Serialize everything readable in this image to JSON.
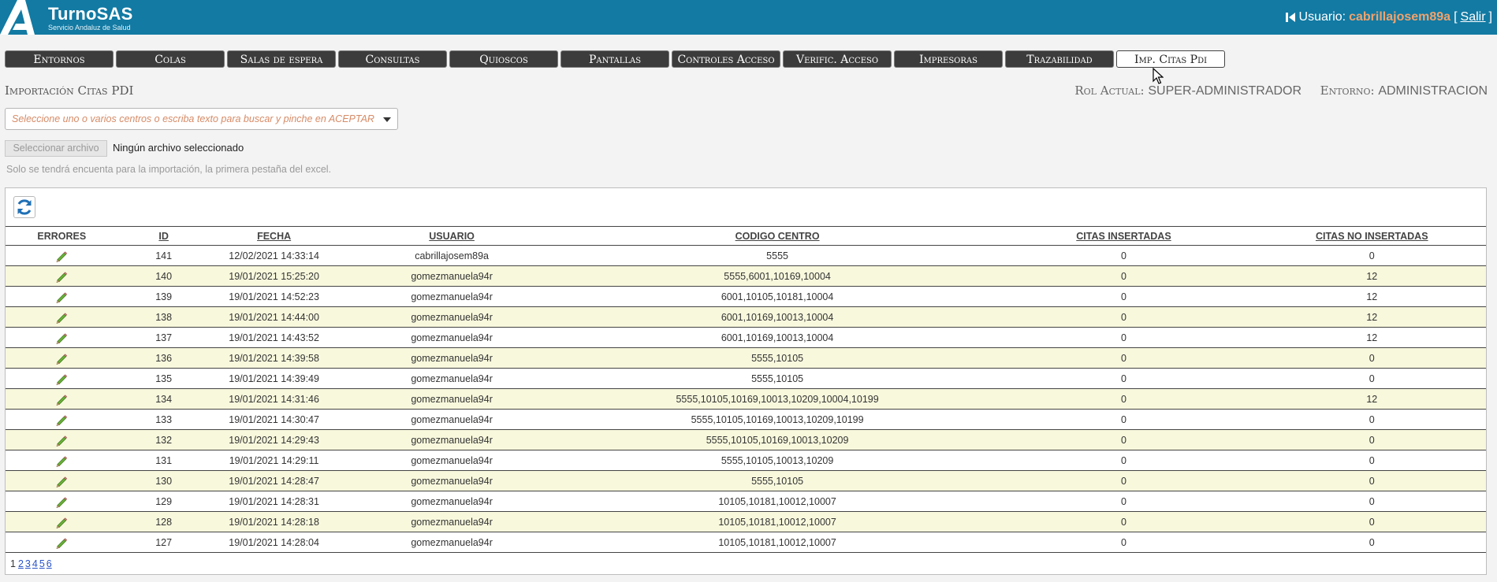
{
  "header": {
    "brand_title": "TurnoSAS",
    "brand_subtitle": "Servicio Andaluz de Salud",
    "user_label": "Usuario:",
    "user_name": "cabrillajosem89a",
    "logout_open": "[",
    "logout_label": "Salir",
    "logout_close": "]",
    "colors": {
      "bar": "#127aa3",
      "user_name": "#f0a36e"
    }
  },
  "tabs": [
    {
      "label": "Entornos",
      "active": false
    },
    {
      "label": "Colas",
      "active": false
    },
    {
      "label": "Salas de espera",
      "active": false
    },
    {
      "label": "Consultas",
      "active": false
    },
    {
      "label": "Quioscos",
      "active": false
    },
    {
      "label": "Pantallas",
      "active": false
    },
    {
      "label": "Controles Acceso",
      "active": false
    },
    {
      "label": "Verific. Acceso",
      "active": false
    },
    {
      "label": "Impresoras",
      "active": false
    },
    {
      "label": "Trazabilidad",
      "active": false
    },
    {
      "label": "Imp. Citas Pdi",
      "active": true
    }
  ],
  "page": {
    "title": "Importación Citas PDI",
    "role_label": "Rol Actual:",
    "role_value": "SUPER-ADMINISTRADOR",
    "env_label": "Entorno:",
    "env_value": "ADMINISTRACION"
  },
  "centers_select": {
    "placeholder": "Seleccione uno o varios centros o escriba texto para buscar y pinche en ACEPTAR"
  },
  "file_upload": {
    "button_label": "Seleccionar archivo",
    "status": "Ningún archivo seleccionado",
    "hint": "Solo se tendrá encuenta para la importación, la primera pestaña del excel."
  },
  "toolbar": {
    "refresh_icon": "refresh-icon"
  },
  "table": {
    "columns": [
      "ERRORES",
      "ID",
      "FECHA",
      "USUARIO",
      "CODIGO CENTRO",
      "CITAS INSERTADAS",
      "CITAS NO INSERTADAS"
    ],
    "rows": [
      {
        "id": "141",
        "fecha": "12/02/2021 14:33:14",
        "usuario": "cabrillajosem89a",
        "codigo": "5555",
        "insertadas": "0",
        "no_insertadas": "0"
      },
      {
        "id": "140",
        "fecha": "19/01/2021 15:25:20",
        "usuario": "gomezmanuela94r",
        "codigo": "5555,6001,10169,10004",
        "insertadas": "0",
        "no_insertadas": "12"
      },
      {
        "id": "139",
        "fecha": "19/01/2021 14:52:23",
        "usuario": "gomezmanuela94r",
        "codigo": "6001,10105,10181,10004",
        "insertadas": "0",
        "no_insertadas": "12"
      },
      {
        "id": "138",
        "fecha": "19/01/2021 14:44:00",
        "usuario": "gomezmanuela94r",
        "codigo": "6001,10169,10013,10004",
        "insertadas": "0",
        "no_insertadas": "12"
      },
      {
        "id": "137",
        "fecha": "19/01/2021 14:43:52",
        "usuario": "gomezmanuela94r",
        "codigo": "6001,10169,10013,10004",
        "insertadas": "0",
        "no_insertadas": "12"
      },
      {
        "id": "136",
        "fecha": "19/01/2021 14:39:58",
        "usuario": "gomezmanuela94r",
        "codigo": "5555,10105",
        "insertadas": "0",
        "no_insertadas": "0"
      },
      {
        "id": "135",
        "fecha": "19/01/2021 14:39:49",
        "usuario": "gomezmanuela94r",
        "codigo": "5555,10105",
        "insertadas": "0",
        "no_insertadas": "0"
      },
      {
        "id": "134",
        "fecha": "19/01/2021 14:31:46",
        "usuario": "gomezmanuela94r",
        "codigo": "5555,10105,10169,10013,10209,10004,10199",
        "insertadas": "0",
        "no_insertadas": "12"
      },
      {
        "id": "133",
        "fecha": "19/01/2021 14:30:47",
        "usuario": "gomezmanuela94r",
        "codigo": "5555,10105,10169,10013,10209,10199",
        "insertadas": "0",
        "no_insertadas": "0"
      },
      {
        "id": "132",
        "fecha": "19/01/2021 14:29:43",
        "usuario": "gomezmanuela94r",
        "codigo": "5555,10105,10169,10013,10209",
        "insertadas": "0",
        "no_insertadas": "0"
      },
      {
        "id": "131",
        "fecha": "19/01/2021 14:29:11",
        "usuario": "gomezmanuela94r",
        "codigo": "5555,10105,10013,10209",
        "insertadas": "0",
        "no_insertadas": "0"
      },
      {
        "id": "130",
        "fecha": "19/01/2021 14:28:47",
        "usuario": "gomezmanuela94r",
        "codigo": "5555,10105",
        "insertadas": "0",
        "no_insertadas": "0"
      },
      {
        "id": "129",
        "fecha": "19/01/2021 14:28:31",
        "usuario": "gomezmanuela94r",
        "codigo": "10105,10181,10012,10007",
        "insertadas": "0",
        "no_insertadas": "0"
      },
      {
        "id": "128",
        "fecha": "19/01/2021 14:28:18",
        "usuario": "gomezmanuela94r",
        "codigo": "10105,10181,10012,10007",
        "insertadas": "0",
        "no_insertadas": "0"
      },
      {
        "id": "127",
        "fecha": "19/01/2021 14:28:04",
        "usuario": "gomezmanuela94r",
        "codigo": "10105,10181,10012,10007",
        "insertadas": "0",
        "no_insertadas": "0"
      }
    ],
    "row_icon": "pencil-icon",
    "alt_row_color": "#f8f8dd"
  },
  "pagination": {
    "current": "1",
    "pages": [
      "2",
      "3",
      "4",
      "5",
      "6"
    ]
  }
}
